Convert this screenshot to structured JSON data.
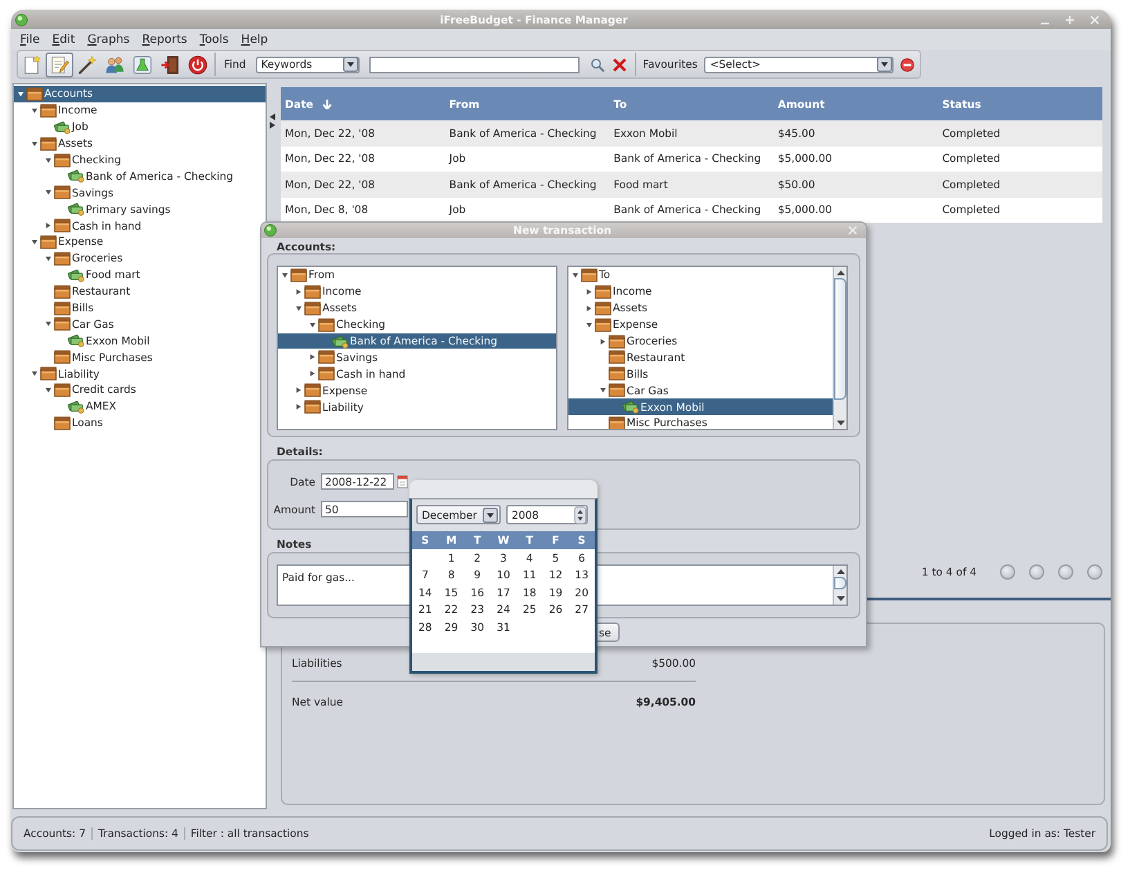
{
  "window": {
    "title": "iFreeBudget - Finance Manager"
  },
  "menu": [
    "File",
    "Edit",
    "Graphs",
    "Reports",
    "Tools",
    "Help"
  ],
  "toolbar": {
    "buttons": [
      {
        "selected": false
      },
      {
        "selected": true
      },
      {
        "selected": false
      },
      {
        "selected": false
      },
      {
        "selected": false
      },
      {
        "selected": false
      },
      {
        "selected": false
      }
    ],
    "find_label": "Find",
    "find_mode": "Keywords",
    "favourites_label": "Favourites",
    "favourites_value": "<Select>"
  },
  "account_tree": [
    {
      "label": "Accounts",
      "kind": "folder",
      "expanded": true,
      "selected": true,
      "children": [
        {
          "label": "Income",
          "kind": "folder",
          "expanded": true,
          "selected": false,
          "children": [
            {
              "label": "Job",
              "kind": "account",
              "selected": false
            }
          ]
        },
        {
          "label": "Assets",
          "kind": "folder",
          "expanded": true,
          "selected": false,
          "children": [
            {
              "label": "Checking",
              "kind": "folder",
              "expanded": true,
              "selected": false,
              "children": [
                {
                  "label": "Bank of America - Checking",
                  "kind": "account",
                  "selected": false
                }
              ]
            },
            {
              "label": "Savings",
              "kind": "folder",
              "expanded": true,
              "selected": false,
              "children": [
                {
                  "label": "Primary savings",
                  "kind": "account",
                  "selected": false
                }
              ]
            },
            {
              "label": "Cash in hand",
              "kind": "folder",
              "expanded": false,
              "selected": false
            }
          ]
        },
        {
          "label": "Expense",
          "kind": "folder",
          "expanded": true,
          "selected": false,
          "children": [
            {
              "label": "Groceries",
              "kind": "folder",
              "expanded": true,
              "selected": false,
              "children": [
                {
                  "label": "Food mart",
                  "kind": "account",
                  "selected": false
                }
              ]
            },
            {
              "label": "Restaurant",
              "kind": "folder",
              "selected": false
            },
            {
              "label": "Bills",
              "kind": "folder",
              "selected": false
            },
            {
              "label": "Car Gas",
              "kind": "folder",
              "expanded": true,
              "selected": false,
              "children": [
                {
                  "label": "Exxon Mobil",
                  "kind": "account",
                  "selected": false
                }
              ]
            },
            {
              "label": "Misc Purchases",
              "kind": "folder",
              "selected": false
            }
          ]
        },
        {
          "label": "Liability",
          "kind": "folder",
          "expanded": true,
          "selected": false,
          "children": [
            {
              "label": "Credit cards",
              "kind": "folder",
              "expanded": true,
              "selected": false,
              "children": [
                {
                  "label": "AMEX",
                  "kind": "account",
                  "selected": false
                }
              ]
            },
            {
              "label": "Loans",
              "kind": "folder",
              "selected": false
            }
          ]
        }
      ]
    }
  ],
  "transactions": {
    "columns": [
      {
        "label": "Date",
        "sorted": true
      },
      {
        "label": "From",
        "sorted": false
      },
      {
        "label": "To",
        "sorted": false
      },
      {
        "label": "Amount",
        "sorted": false
      },
      {
        "label": "Status",
        "sorted": false
      }
    ],
    "rows": [
      [
        "Mon, Dec 22, '08",
        "Bank of America - Checking",
        "Exxon Mobil",
        "$45.00",
        "Completed"
      ],
      [
        "Mon, Dec 22, '08",
        "Job",
        "Bank of America - Checking",
        "$5,000.00",
        "Completed"
      ],
      [
        "Mon, Dec 22, '08",
        "Bank of America - Checking",
        "Food mart",
        "$50.00",
        "Completed"
      ],
      [
        "Mon, Dec 8, '08",
        "Job",
        "Bank of America - Checking",
        "$5,000.00",
        "Completed"
      ]
    ],
    "page_info": "1 to 4 of 4"
  },
  "summary": [
    {
      "kind": "line",
      "label": "Liabilities",
      "value": "$500.00"
    },
    {
      "kind": "total",
      "label": "Net value",
      "value": "$9,405.00"
    }
  ],
  "status_bar": {
    "items": [
      "Accounts: 7",
      "Transactions: 4",
      "Filter : all transactions"
    ],
    "user": "Logged in as: Tester"
  },
  "dialog": {
    "title": "New transaction",
    "accounts_label": "Accounts:",
    "from_tree": [
      {
        "label": "From",
        "kind": "folder",
        "expanded": true,
        "selected": false,
        "children": [
          {
            "label": "Income",
            "kind": "folder",
            "expanded": false,
            "selected": false
          },
          {
            "label": "Assets",
            "kind": "folder",
            "expanded": true,
            "selected": false,
            "children": [
              {
                "label": "Checking",
                "kind": "folder",
                "expanded": true,
                "selected": false,
                "children": [
                  {
                    "label": "Bank of America - Checking",
                    "kind": "account",
                    "selected": true
                  }
                ]
              },
              {
                "label": "Savings",
                "kind": "folder",
                "expanded": false,
                "selected": false
              },
              {
                "label": "Cash in hand",
                "kind": "folder",
                "expanded": false,
                "selected": false
              }
            ]
          },
          {
            "label": "Expense",
            "kind": "folder",
            "expanded": false,
            "selected": false
          },
          {
            "label": "Liability",
            "kind": "folder",
            "expanded": false,
            "selected": false
          }
        ]
      }
    ],
    "to_tree": [
      {
        "label": "To",
        "kind": "folder",
        "expanded": true,
        "selected": false,
        "children": [
          {
            "label": "Income",
            "kind": "folder",
            "expanded": false,
            "selected": false
          },
          {
            "label": "Assets",
            "kind": "folder",
            "expanded": false,
            "selected": false
          },
          {
            "label": "Expense",
            "kind": "folder",
            "expanded": true,
            "selected": false,
            "children": [
              {
                "label": "Groceries",
                "kind": "folder",
                "expanded": false,
                "selected": false
              },
              {
                "label": "Restaurant",
                "kind": "folder",
                "selected": false
              },
              {
                "label": "Bills",
                "kind": "folder",
                "selected": false
              },
              {
                "label": "Car Gas",
                "kind": "folder",
                "expanded": true,
                "selected": false,
                "children": [
                  {
                    "label": "Exxon Mobil",
                    "kind": "account",
                    "selected": true
                  }
                ]
              },
              {
                "label": "Misc Purchases",
                "kind": "folder",
                "selected": false
              }
            ]
          }
        ]
      }
    ],
    "details_label": "Details:",
    "date_label": "Date",
    "date_value": "2008-12-22",
    "amount_label": "Amount",
    "amount_value": "50",
    "notes_label": "Notes",
    "notes_value": "Paid for gas...",
    "buttons": [
      "se"
    ]
  },
  "date_picker": {
    "month": "December",
    "year": "2008",
    "weekdays": [
      "S",
      "M",
      "T",
      "W",
      "T",
      "F",
      "S"
    ],
    "weeks": [
      [
        "1",
        "2",
        "3",
        "4",
        "5",
        "6"
      ],
      [
        "7",
        "8",
        "9",
        "10",
        "11",
        "12",
        "13"
      ],
      [
        "14",
        "15",
        "16",
        "17",
        "18",
        "19",
        "20"
      ],
      [
        "21",
        "22",
        "23",
        "24",
        "25",
        "26",
        "27"
      ],
      [
        "28",
        "29",
        "30",
        "31"
      ]
    ]
  }
}
